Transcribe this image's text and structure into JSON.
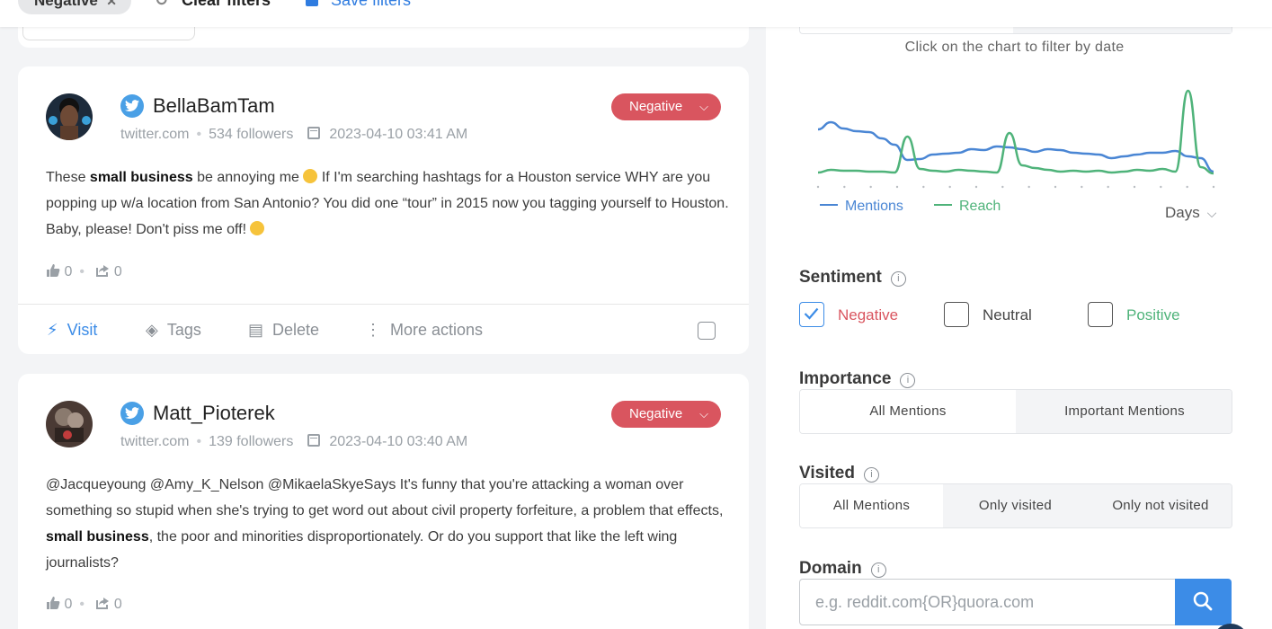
{
  "topbar": {
    "chip_label": "Negative",
    "clear_label": "Clear filters",
    "save_label": "Save filters"
  },
  "mentions": [
    {
      "username": "BellaBamTam",
      "source": "twitter.com",
      "followers": "534 followers",
      "date": "2023-04-10 03:41 AM",
      "sentiment": "Negative",
      "text_parts": [
        "These ",
        "small business",
        " be annoying me ",
        " If I'm searching hashtags for a Houston service WHY are you popping up w/a location from San Antonio? You did one “tour” in 2015 now you tagging yourself to Houston. Baby, please! Don't piss me off! "
      ],
      "likes": "0",
      "shares": "0"
    },
    {
      "username": "Matt_Pioterek",
      "source": "twitter.com",
      "followers": "139 followers",
      "date": "2023-04-10 03:40 AM",
      "sentiment": "Negative",
      "text_parts": [
        "@Jacqueyoung @Amy_K_Nelson @MikaelaSkyeSays It's funny that you're attacking a woman over something so stupid when she's trying to get word out about civil property forfeiture, a problem that effects, ",
        "small business",
        ", the poor and minorities disproportionately. Or do you support that like the left wing journalists?"
      ],
      "likes": "0",
      "shares": "0"
    }
  ],
  "actions": {
    "visit": "Visit",
    "tags": "Tags",
    "delete": "Delete",
    "more": "More actions"
  },
  "sidebar": {
    "chart_hint": "Click on the chart to filter by date",
    "legend_mentions": "Mentions",
    "legend_reach": "Reach",
    "interval": "Days",
    "sentiment_title": "Sentiment",
    "sentiment_options": [
      "Negative",
      "Neutral",
      "Positive"
    ],
    "importance_title": "Importance",
    "importance_options": [
      "All Mentions",
      "Important Mentions"
    ],
    "visited_title": "Visited",
    "visited_options": [
      "All Mentions",
      "Only visited",
      "Only not visited"
    ],
    "domain_title": "Domain",
    "domain_placeholder": "e.g. reddit.com{OR}quora.com"
  },
  "colors": {
    "mentions": "#4a86d4",
    "reach": "#4fb37a",
    "negative": "#d9555f",
    "positive": "#4fb37a",
    "accent": "#3c8ce7"
  },
  "chart_data": {
    "type": "line",
    "x": [
      1,
      2,
      3,
      4,
      5,
      6,
      7,
      8,
      9,
      10,
      11,
      12,
      13,
      14,
      15,
      16,
      17,
      18,
      19,
      20,
      21,
      22,
      23,
      24,
      25,
      26,
      27,
      28,
      29,
      30,
      31,
      32
    ],
    "series": [
      {
        "name": "Mentions",
        "values": [
          52,
          60,
          53,
          50,
          49,
          42,
          35,
          18,
          19,
          24,
          25,
          26,
          30,
          29,
          33,
          32,
          30,
          27,
          30,
          29,
          26,
          25,
          24,
          20,
          22,
          24,
          26,
          26,
          28,
          22,
          20,
          5
        ]
      },
      {
        "name": "Reach",
        "values": [
          4,
          7,
          6,
          6,
          5,
          5,
          4,
          44,
          8,
          6,
          5,
          7,
          6,
          5,
          4,
          48,
          12,
          9,
          7,
          5,
          6,
          5,
          6,
          4,
          5,
          7,
          6,
          8,
          5,
          95,
          10,
          3
        ]
      }
    ],
    "ylim": [
      0,
      100
    ],
    "grid": false,
    "legend": "bottom-left"
  }
}
